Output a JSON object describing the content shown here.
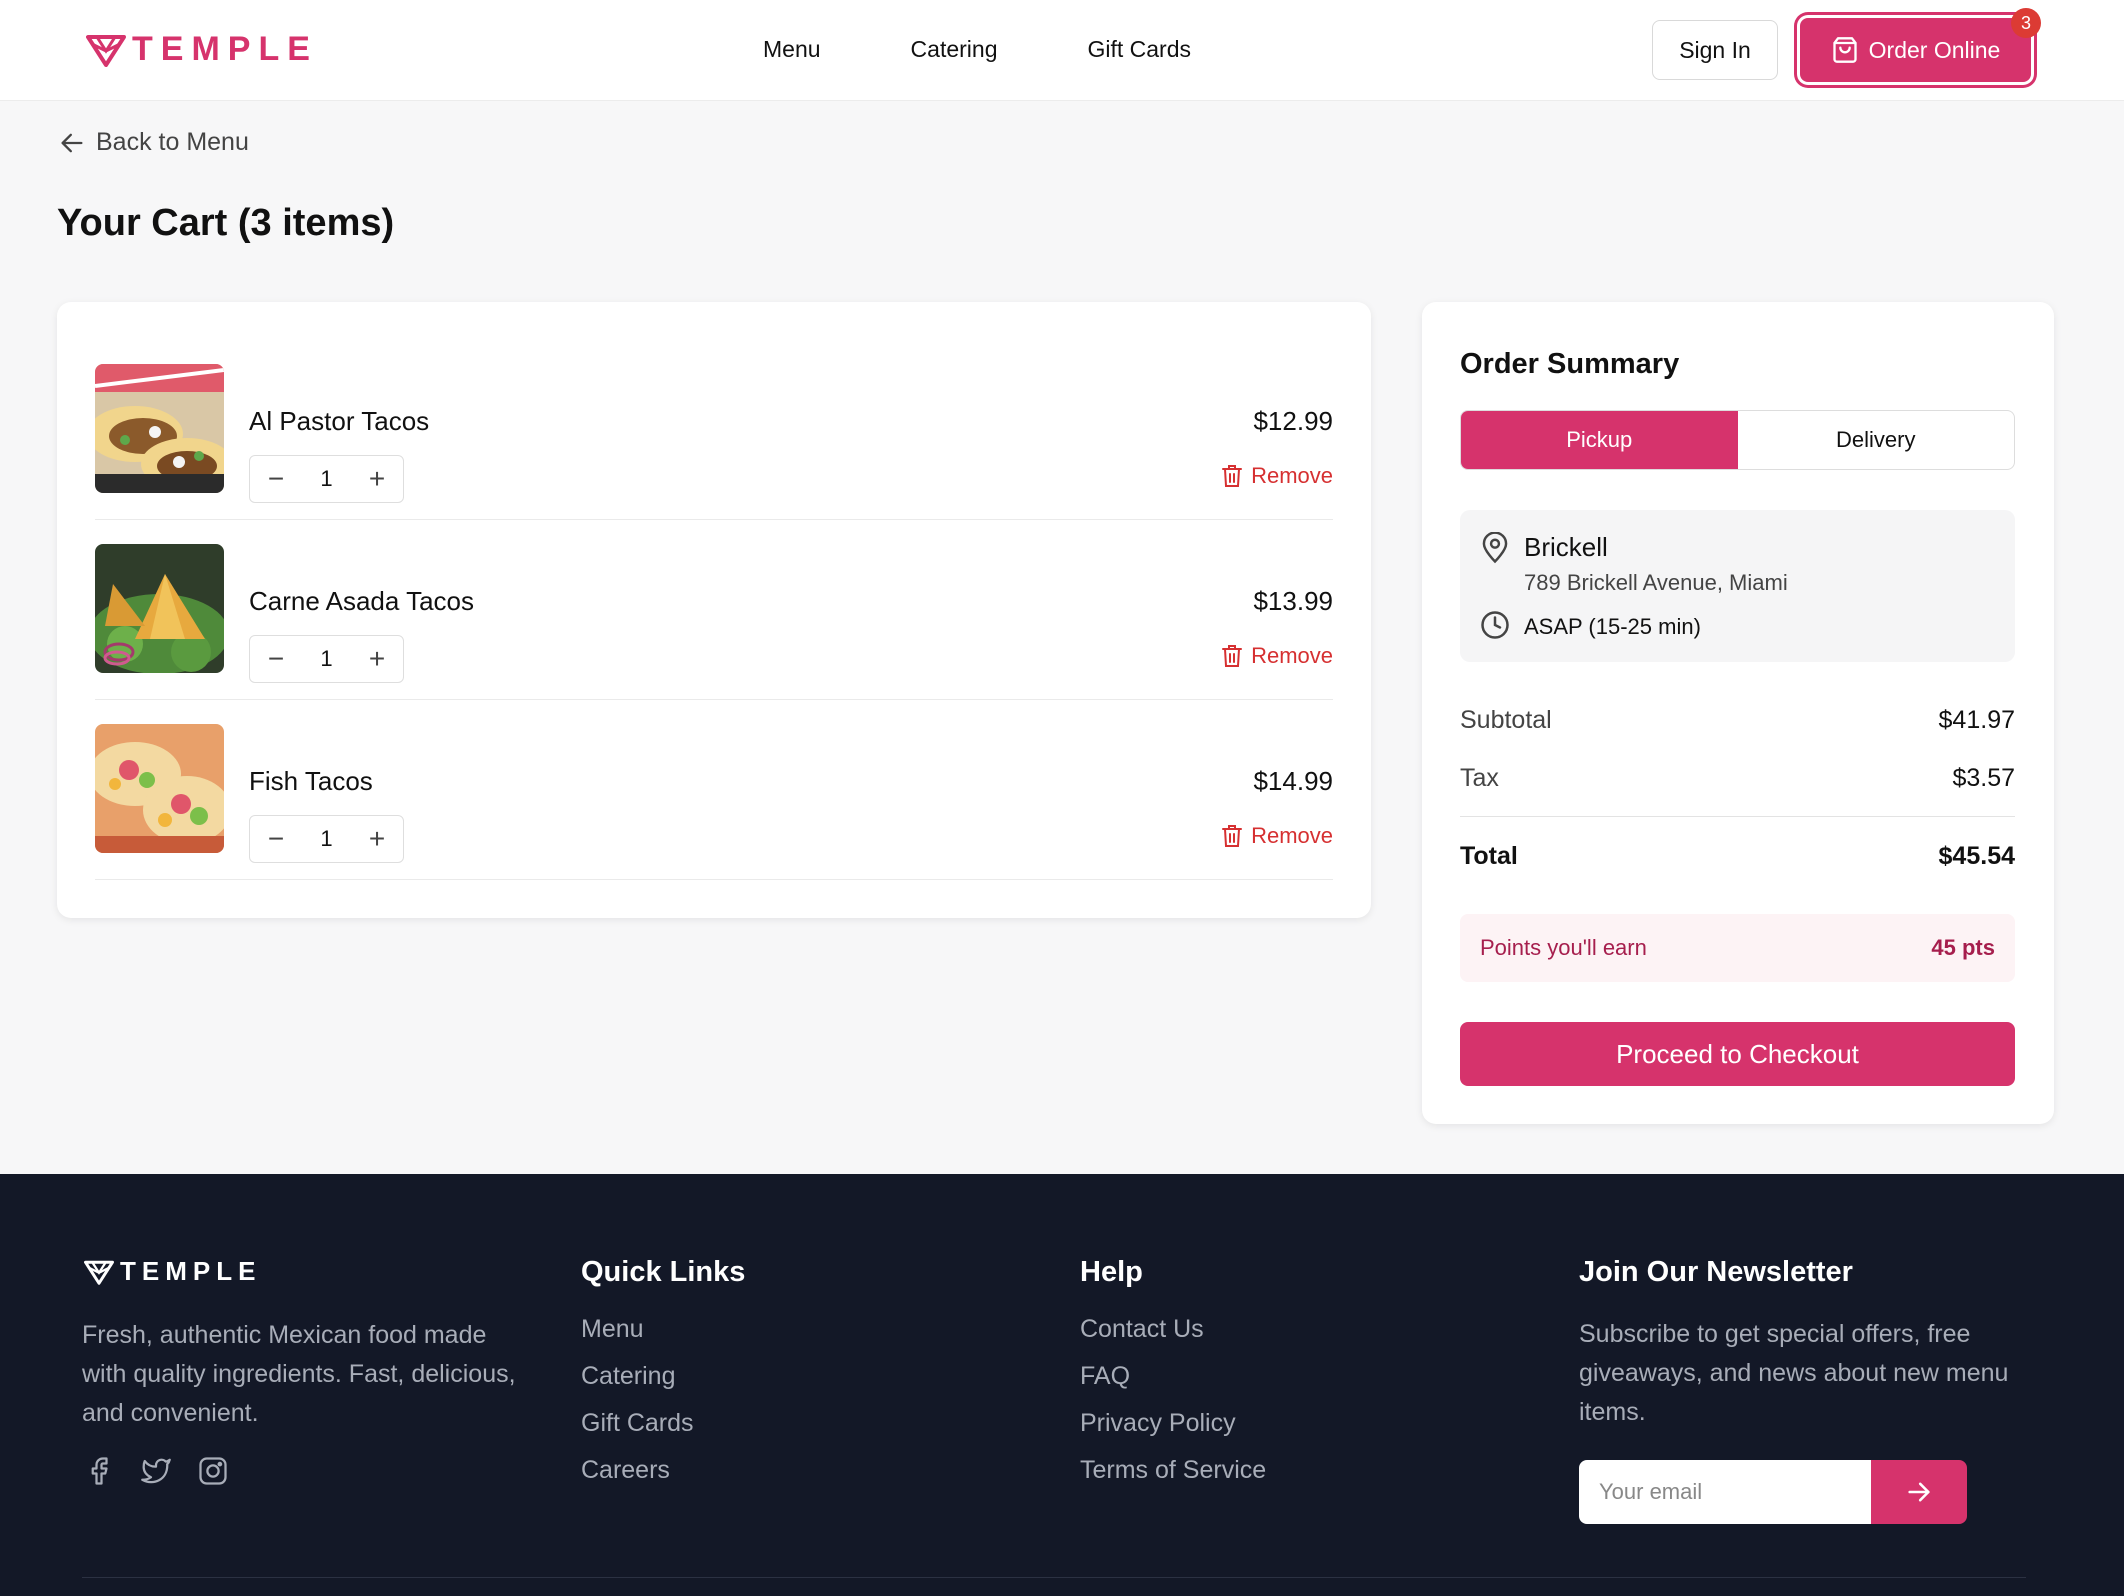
{
  "brand": {
    "name": "TEMPLE",
    "accent_color": "#d6336c"
  },
  "header": {
    "nav": [
      "Menu",
      "Catering",
      "Gift Cards"
    ],
    "sign_in": "Sign In",
    "order_online": "Order Online",
    "cart_count": "3"
  },
  "back_label": "Back to Menu",
  "page_title": "Your Cart (3 items)",
  "cart": {
    "items": [
      {
        "name": "Al Pastor Tacos",
        "qty": "1",
        "price": "$12.99",
        "remove": "Remove",
        "minus": "−",
        "plus": "+"
      },
      {
        "name": "Carne Asada Tacos",
        "qty": "1",
        "price": "$13.99",
        "remove": "Remove",
        "minus": "−",
        "plus": "+"
      },
      {
        "name": "Fish Tacos",
        "qty": "1",
        "price": "$14.99",
        "remove": "Remove",
        "minus": "−",
        "plus": "+"
      }
    ]
  },
  "summary": {
    "title": "Order Summary",
    "modes": [
      "Pickup",
      "Delivery"
    ],
    "selected_mode": "Pickup",
    "location": {
      "name": "Brickell",
      "address": "789 Brickell Avenue, Miami",
      "time": "ASAP (15-25 min)"
    },
    "subtotal_label": "Subtotal",
    "subtotal": "$41.97",
    "tax_label": "Tax",
    "tax": "$3.57",
    "total_label": "Total",
    "total": "$45.54",
    "points_label": "Points you'll earn",
    "points": "45 pts",
    "checkout": "Proceed to Checkout"
  },
  "footer": {
    "logo": "TEMPLE",
    "about": "Fresh, authentic Mexican food made with quality ingredients. Fast, delicious, and convenient.",
    "quick_links_title": "Quick Links",
    "quick_links": [
      "Menu",
      "Catering",
      "Gift Cards",
      "Careers"
    ],
    "help_title": "Help",
    "help_links": [
      "Contact Us",
      "FAQ",
      "Privacy Policy",
      "Terms of Service"
    ],
    "newsletter_title": "Join Our Newsletter",
    "newsletter_text": "Subscribe to get special offers, free giveaways, and news about new menu items.",
    "email_placeholder": "Your email"
  }
}
